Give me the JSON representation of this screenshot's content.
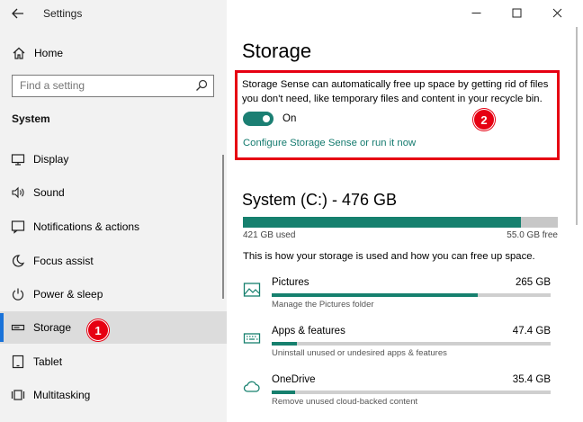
{
  "window": {
    "title": "Settings",
    "controls": {
      "minimize": "—",
      "maximize": "☐",
      "close": "✕"
    }
  },
  "sidebar": {
    "home_label": "Home",
    "search_placeholder": "Find a setting",
    "section_label": "System",
    "items": [
      {
        "label": "Display",
        "icon": "display-icon"
      },
      {
        "label": "Sound",
        "icon": "sound-icon"
      },
      {
        "label": "Notifications & actions",
        "icon": "notifications-icon"
      },
      {
        "label": "Focus assist",
        "icon": "moon-icon"
      },
      {
        "label": "Power & sleep",
        "icon": "power-icon"
      },
      {
        "label": "Storage",
        "icon": "storage-icon",
        "selected": true
      },
      {
        "label": "Tablet",
        "icon": "tablet-icon"
      },
      {
        "label": "Multitasking",
        "icon": "multitasking-icon"
      }
    ]
  },
  "badges": {
    "first": "1",
    "second": "2"
  },
  "main": {
    "page_title": "Storage",
    "storage_sense": {
      "description": "Storage Sense can automatically free up space by getting rid of files you don't need, like temporary files and content in your recycle bin.",
      "toggle_state": "On",
      "toggle_on": true,
      "configure_link": "Configure Storage Sense or run it now"
    },
    "drive": {
      "title": "System (C:) - 476 GB",
      "used": "421 GB used",
      "free": "55.0 GB free",
      "used_fraction": 0.884,
      "description": "This is how your storage is used and how you can free up space."
    },
    "categories": [
      {
        "name": "Pictures",
        "size": "265 GB",
        "desc": "Manage the Pictures folder",
        "fraction": 0.74,
        "icon": "pictures-icon"
      },
      {
        "name": "Apps & features",
        "size": "47.4 GB",
        "desc": "Uninstall unused or undesired apps & features",
        "fraction": 0.09,
        "icon": "keyboard-icon"
      },
      {
        "name": "OneDrive",
        "size": "35.4 GB",
        "desc": "Remove unused cloud-backed content",
        "fraction": 0.085,
        "icon": "cloud-icon"
      }
    ]
  },
  "colors": {
    "accent": "#16806e",
    "link": "#137a6e",
    "highlight": "#e60012",
    "selection": "#1a73d9"
  }
}
